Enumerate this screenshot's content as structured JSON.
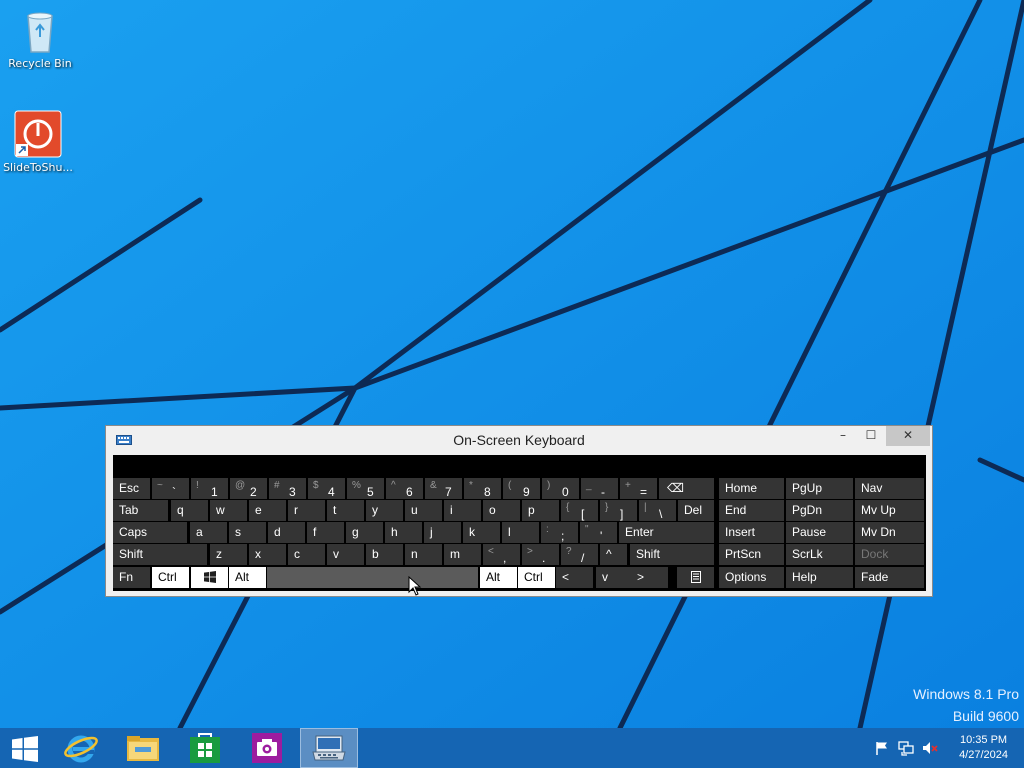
{
  "desktop": {
    "icons": [
      {
        "label": "Recycle Bin",
        "icon": "recycle-bin-icon"
      },
      {
        "label": "SlideToShu...",
        "icon": "slide-to-shutdown-icon"
      }
    ],
    "watermark": {
      "line1": "Windows 8.1 Pro",
      "line2": "Build 9600"
    }
  },
  "osk": {
    "title": "On-Screen Keyboard",
    "minimize": "–",
    "maximize": "☐",
    "close": "✕",
    "rows": {
      "r1": [
        {
          "name": "esc",
          "label": "Esc"
        },
        {
          "name": "grave",
          "shift": "~",
          "main": "`"
        },
        {
          "name": "1",
          "shift": "!",
          "main": "1"
        },
        {
          "name": "2",
          "shift": "@",
          "main": "2"
        },
        {
          "name": "3",
          "shift": "#",
          "main": "3"
        },
        {
          "name": "4",
          "shift": "$",
          "main": "4"
        },
        {
          "name": "5",
          "shift": "%",
          "main": "5"
        },
        {
          "name": "6",
          "shift": "^",
          "main": "6"
        },
        {
          "name": "7",
          "shift": "&",
          "main": "7"
        },
        {
          "name": "8",
          "shift": "*",
          "main": "8"
        },
        {
          "name": "9",
          "shift": "(",
          "main": "9"
        },
        {
          "name": "0",
          "shift": ")",
          "main": "0"
        },
        {
          "name": "minus",
          "shift": "_",
          "main": "-"
        },
        {
          "name": "equals",
          "shift": "+",
          "main": "="
        },
        {
          "name": "backspace",
          "label": "⌫"
        }
      ],
      "r2": [
        {
          "name": "tab",
          "label": "Tab"
        },
        {
          "name": "q",
          "label": "q"
        },
        {
          "name": "w",
          "label": "w"
        },
        {
          "name": "e",
          "label": "e"
        },
        {
          "name": "r",
          "label": "r"
        },
        {
          "name": "t",
          "label": "t"
        },
        {
          "name": "y",
          "label": "y"
        },
        {
          "name": "u",
          "label": "u"
        },
        {
          "name": "i",
          "label": "i"
        },
        {
          "name": "o",
          "label": "o"
        },
        {
          "name": "p",
          "label": "p"
        },
        {
          "name": "lbracket",
          "shift": "{",
          "main": "["
        },
        {
          "name": "rbracket",
          "shift": "}",
          "main": "]"
        },
        {
          "name": "backslash",
          "shift": "|",
          "main": "\\"
        },
        {
          "name": "del",
          "label": "Del"
        }
      ],
      "r3": [
        {
          "name": "caps",
          "label": "Caps"
        },
        {
          "name": "a",
          "label": "a"
        },
        {
          "name": "s",
          "label": "s"
        },
        {
          "name": "d",
          "label": "d"
        },
        {
          "name": "f",
          "label": "f"
        },
        {
          "name": "g",
          "label": "g"
        },
        {
          "name": "h",
          "label": "h"
        },
        {
          "name": "j",
          "label": "j"
        },
        {
          "name": "k",
          "label": "k"
        },
        {
          "name": "l",
          "label": "l"
        },
        {
          "name": "semicolon",
          "shift": ":",
          "main": ";"
        },
        {
          "name": "quote",
          "shift": "\"",
          "main": "'"
        },
        {
          "name": "enter",
          "label": "Enter"
        }
      ],
      "r4": [
        {
          "name": "shift-left",
          "label": "Shift"
        },
        {
          "name": "z",
          "label": "z"
        },
        {
          "name": "x",
          "label": "x"
        },
        {
          "name": "c",
          "label": "c"
        },
        {
          "name": "v",
          "label": "v"
        },
        {
          "name": "b",
          "label": "b"
        },
        {
          "name": "n",
          "label": "n"
        },
        {
          "name": "m",
          "label": "m"
        },
        {
          "name": "comma",
          "shift": "<",
          "main": ","
        },
        {
          "name": "period",
          "shift": ">",
          "main": "."
        },
        {
          "name": "slash",
          "shift": "?",
          "main": "/"
        },
        {
          "name": "up",
          "label": "^"
        },
        {
          "name": "shift-right",
          "label": "Shift"
        }
      ],
      "r5": [
        {
          "name": "fn",
          "label": "Fn"
        },
        {
          "name": "ctrl-left",
          "label": "Ctrl"
        },
        {
          "name": "win",
          "label": ""
        },
        {
          "name": "alt-left",
          "label": "Alt"
        },
        {
          "name": "space",
          "label": ""
        },
        {
          "name": "alt-right",
          "label": "Alt"
        },
        {
          "name": "ctrl-right",
          "label": "Ctrl"
        },
        {
          "name": "left",
          "label": "<"
        },
        {
          "name": "down",
          "label": "v"
        },
        {
          "name": "right",
          "label": ">"
        },
        {
          "name": "menu",
          "label": ""
        }
      ]
    },
    "nav": [
      [
        "Home",
        "PgUp",
        "Nav"
      ],
      [
        "End",
        "PgDn",
        "Mv Up"
      ],
      [
        "Insert",
        "Pause",
        "Mv Dn"
      ],
      [
        "PrtScn",
        "ScrLk",
        "Dock"
      ],
      [
        "Options",
        "Help",
        "Fade"
      ]
    ]
  },
  "taskbar": {
    "items": [
      {
        "name": "start",
        "icon": "windows-start-icon"
      },
      {
        "name": "internet-explorer",
        "icon": "internet-explorer-icon"
      },
      {
        "name": "file-explorer",
        "icon": "file-explorer-icon"
      },
      {
        "name": "store",
        "icon": "store-icon"
      },
      {
        "name": "camera",
        "icon": "camera-icon"
      },
      {
        "name": "on-screen-keyboard",
        "icon": "keyboard-icon",
        "active": true
      }
    ],
    "tray": [
      "action-center-flag-icon",
      "network-icon",
      "volume-muted-icon"
    ],
    "clock": {
      "time": "10:35 PM",
      "date": "4/27/2024"
    }
  },
  "colors": {
    "desktop": "#0f90e8",
    "taskbar": "#1565b3",
    "key": "#343434",
    "key_light": "#ffffff"
  }
}
